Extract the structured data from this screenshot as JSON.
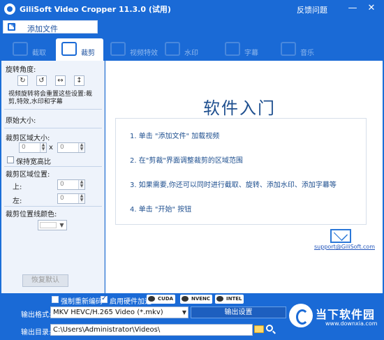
{
  "window": {
    "title": "GiliSoft Video Cropper 11.3.0 (试用)",
    "feedback": "反馈问题",
    "minimize_glyph": "—",
    "close_glyph": "✕"
  },
  "toolbar": {
    "add_file": "添加文件"
  },
  "tabs": [
    {
      "label": "截取",
      "icon": "scissors-icon",
      "active": false
    },
    {
      "label": "裁剪",
      "icon": "crop-icon",
      "active": true
    },
    {
      "label": "视频特效",
      "icon": "effects-icon",
      "active": false
    },
    {
      "label": "水印",
      "icon": "watermark-icon",
      "active": false
    },
    {
      "label": "字幕",
      "icon": "subtitle-icon",
      "active": false
    },
    {
      "label": "音乐",
      "icon": "music-icon",
      "active": false
    }
  ],
  "crop_panel": {
    "rotate_angle_label": "旋转角度:",
    "rotate_buttons": [
      {
        "glyph": "↻",
        "icon": "rotate-clockwise-icon"
      },
      {
        "glyph": "↺",
        "icon": "rotate-counterclockwise-icon"
      },
      {
        "glyph": "↔",
        "icon": "flip-horizontal-icon"
      },
      {
        "glyph": "↕",
        "icon": "flip-vertical-icon"
      }
    ],
    "rotate_note_1": "视频旋转将会重置这些设置:裁",
    "rotate_note_2": "剪,特效,水印和字幕",
    "original_size_label": "原始大小:",
    "crop_size_label": "裁剪区域大小:",
    "width_value": "0",
    "height_value": "0",
    "times_sign": "x",
    "keep_ratio_label": "保持宽高比",
    "crop_position_label": "裁剪区域位置:",
    "top_label": "上:",
    "top_value": "0",
    "left_label": "左:",
    "left_value": "0",
    "line_color_label": "裁剪位置线颜色:",
    "line_color": "#ffffff",
    "reset_button": "恢复默认"
  },
  "main": {
    "heading": "软件入门",
    "steps": [
      "1. 单击 \"添加文件\" 加载视频",
      "2. 在\"剪裁\"界面调整裁剪的区域范围",
      "3. 如果需要,你还可以同时进行截取、旋转、添加水印、添加字幕等",
      "4. 单击 \"开始\" 按钮"
    ],
    "support_link": "support@GiliSoft.com"
  },
  "bottom": {
    "force_reencode_label": "强制重新编码",
    "force_reencode_checked": false,
    "hw_accel_label": "启用硬件加速",
    "hw_accel_checked": true,
    "accel_badges": [
      "CUDA",
      "NVENC",
      "INTEL"
    ],
    "output_format_label": "输出格式:",
    "output_format_value": "MKV HEVC/H.265 Video (*.mkv)",
    "output_settings_button": "输出设置",
    "output_dir_label": "输出目录:",
    "output_dir_value": "C:\\Users\\Administrator\\Videos\\"
  },
  "watermark": {
    "brand": "当下软件园",
    "url": "www.downxia.com"
  },
  "colors": {
    "titlebar_blue": "#1a6ad6",
    "panel_bg": "#eef3fb",
    "heading_blue": "#1e4f8f"
  }
}
